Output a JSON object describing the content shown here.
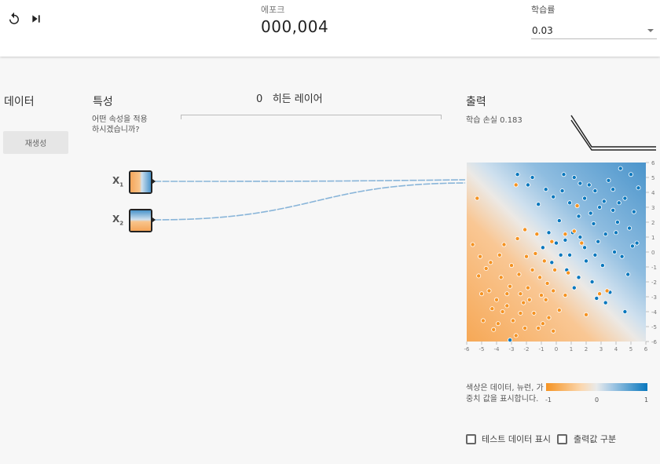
{
  "header": {
    "epoch_label": "에포크",
    "epoch_value": "000,004",
    "learning_rate_label": "학습률",
    "learning_rate_value": "0.03",
    "reset_icon": "reset-icon",
    "step_icon": "step-icon"
  },
  "data_panel": {
    "title": "데이터",
    "regenerate_label": "재생성"
  },
  "features_panel": {
    "title": "특성",
    "description": "어떤 속성을 적용하시겠습니까?",
    "features": [
      {
        "name": "X",
        "sub": "1"
      },
      {
        "name": "X",
        "sub": "2"
      }
    ]
  },
  "hidden_layers": {
    "count": "0",
    "label": "히든 레이어"
  },
  "output_panel": {
    "title": "출력",
    "loss_text": "학습 손실 0.183",
    "legend_text": "색상은 데이터, 뉴런, 가중치 값을 표시합니다.",
    "colorbar_ticks": [
      "-1",
      "0",
      "1"
    ],
    "show_test_data_label": "테스트 데이터 표시",
    "discretize_label": "출력값 구분",
    "show_test_data_checked": false,
    "discretize_checked": false
  },
  "colors": {
    "orange": "#f59322",
    "blue": "#0877bd",
    "neutral": "#e8eaeb"
  },
  "chart_data": {
    "type": "scatter",
    "title": "",
    "xlabel": "",
    "ylabel": "",
    "xlim": [
      -6,
      6
    ],
    "ylim": [
      -6,
      6
    ],
    "x_ticks": [
      "-6",
      "-5",
      "-4",
      "-3",
      "-2",
      "-1",
      "0",
      "1",
      "2",
      "3",
      "4",
      "5",
      "6"
    ],
    "y_ticks": [
      "6",
      "5",
      "4",
      "3",
      "2",
      "1",
      "0",
      "-1",
      "-2",
      "-3",
      "-4",
      "-5",
      "-6"
    ],
    "background": "decision boundary gradient: orange lower-left, blue upper-right, boundary along y = -x",
    "series": [
      {
        "color": "blue",
        "points": [
          [
            0.5,
            5.2
          ],
          [
            1.2,
            5.0
          ],
          [
            2.2,
            4.5
          ],
          [
            3.5,
            4.8
          ],
          [
            4.3,
            5.6
          ],
          [
            5.0,
            5.2
          ],
          [
            2.6,
            4.1
          ],
          [
            1.9,
            3.6
          ],
          [
            4.6,
            3.6
          ],
          [
            0.9,
            3.3
          ],
          [
            2.9,
            3.0
          ],
          [
            3.8,
            2.8
          ],
          [
            5.2,
            2.7
          ],
          [
            1.5,
            2.4
          ],
          [
            4.1,
            2.0
          ],
          [
            0.2,
            2.1
          ],
          [
            2.5,
            1.9
          ],
          [
            4.9,
            1.6
          ],
          [
            1.1,
            1.3
          ],
          [
            3.3,
            1.2
          ],
          [
            0.6,
            0.8
          ],
          [
            2.8,
            0.7
          ],
          [
            5.4,
            0.6
          ],
          [
            1.9,
            0.3
          ],
          [
            3.9,
            0.0
          ],
          [
            0.3,
            -0.2
          ],
          [
            2.0,
            -0.6
          ],
          [
            3.1,
            -0.9
          ],
          [
            4.8,
            -1.5
          ],
          [
            1.5,
            -1.7
          ],
          [
            0.7,
            -1.2
          ],
          [
            2.4,
            -2.0
          ],
          [
            3.6,
            -2.7
          ],
          [
            1.2,
            -2.4
          ],
          [
            2.7,
            -3.1
          ],
          [
            4.6,
            -4.0
          ],
          [
            -1.6,
            5.0
          ],
          [
            -2.6,
            5.2
          ],
          [
            -1.9,
            4.5
          ],
          [
            -0.7,
            4.2
          ],
          [
            -1.2,
            3.2
          ],
          [
            -0.2,
            3.7
          ],
          [
            -0.5,
            1.3
          ],
          [
            0.0,
            0.6
          ],
          [
            3.2,
            3.4
          ],
          [
            5.5,
            4.3
          ],
          [
            3.8,
            4.2
          ],
          [
            2.3,
            2.6
          ],
          [
            4.2,
            3.3
          ],
          [
            1.6,
            4.6
          ],
          [
            0.4,
            4.1
          ],
          [
            5.1,
            0.4
          ],
          [
            4.4,
            -0.3
          ],
          [
            3.3,
            -3.4
          ],
          [
            -0.3,
            -0.7
          ],
          [
            0.9,
            -0.2
          ],
          [
            1.6,
            1.0
          ],
          [
            2.6,
            -0.2
          ],
          [
            4.0,
            1.3
          ],
          [
            -0.9,
            0.3
          ],
          [
            -3.1,
            -5.9
          ]
        ]
      },
      {
        "color": "orange",
        "points": [
          [
            -5.3,
            3.6
          ],
          [
            -5.6,
            0.5
          ],
          [
            -5.1,
            -0.3
          ],
          [
            -4.4,
            -0.7
          ],
          [
            -3.8,
            -0.2
          ],
          [
            -3.5,
            0.5
          ],
          [
            -2.6,
            0.9
          ],
          [
            -2.1,
            1.5
          ],
          [
            -1.3,
            1.2
          ],
          [
            -0.3,
            0.7
          ],
          [
            0.6,
            1.2
          ],
          [
            -5.2,
            -1.6
          ],
          [
            -4.5,
            -2.6
          ],
          [
            -3.7,
            -1.7
          ],
          [
            -3.1,
            -2.3
          ],
          [
            -2.5,
            -1.5
          ],
          [
            -1.9,
            -2.4
          ],
          [
            -1.1,
            -1.7
          ],
          [
            -0.6,
            -2.1
          ],
          [
            -0.1,
            -1.2
          ],
          [
            -4.9,
            -4.6
          ],
          [
            -4.2,
            -5.2
          ],
          [
            -3.6,
            -4.0
          ],
          [
            -2.9,
            -4.6
          ],
          [
            -2.2,
            -3.4
          ],
          [
            -1.5,
            -4.1
          ],
          [
            -0.7,
            -3.2
          ],
          [
            -0.2,
            -5.3
          ],
          [
            -2.7,
            -5.6
          ],
          [
            -1.2,
            -5.1
          ],
          [
            -4.0,
            -3.2
          ],
          [
            -3.3,
            -3.6
          ],
          [
            -2.4,
            -2.8
          ],
          [
            -1.8,
            -3.2
          ],
          [
            -1.0,
            -2.9
          ],
          [
            -0.5,
            -4.4
          ],
          [
            0.2,
            -3.9
          ],
          [
            -4.7,
            -1.1
          ],
          [
            -3.0,
            -0.9
          ],
          [
            -2.0,
            -0.3
          ],
          [
            -1.4,
            -0.1
          ],
          [
            -0.8,
            -0.6
          ],
          [
            0.8,
            -1.4
          ],
          [
            1.7,
            0.6
          ],
          [
            1.2,
            1.4
          ],
          [
            2.9,
            -2.8
          ],
          [
            3.4,
            -2.6
          ],
          [
            -2.7,
            4.5
          ],
          [
            1.4,
            3.1
          ],
          [
            2.0,
            -4.2
          ],
          [
            -5.0,
            -2.8
          ],
          [
            -3.9,
            -4.8
          ],
          [
            -2.1,
            -5.1
          ],
          [
            -1.6,
            -1.2
          ],
          [
            -0.2,
            -2.6
          ],
          [
            0.6,
            -2.9
          ],
          [
            -3.3,
            -2.8
          ],
          [
            -4.3,
            -3.8
          ],
          [
            -2.4,
            -4.1
          ],
          [
            -0.9,
            -4.8
          ]
        ]
      }
    ]
  }
}
